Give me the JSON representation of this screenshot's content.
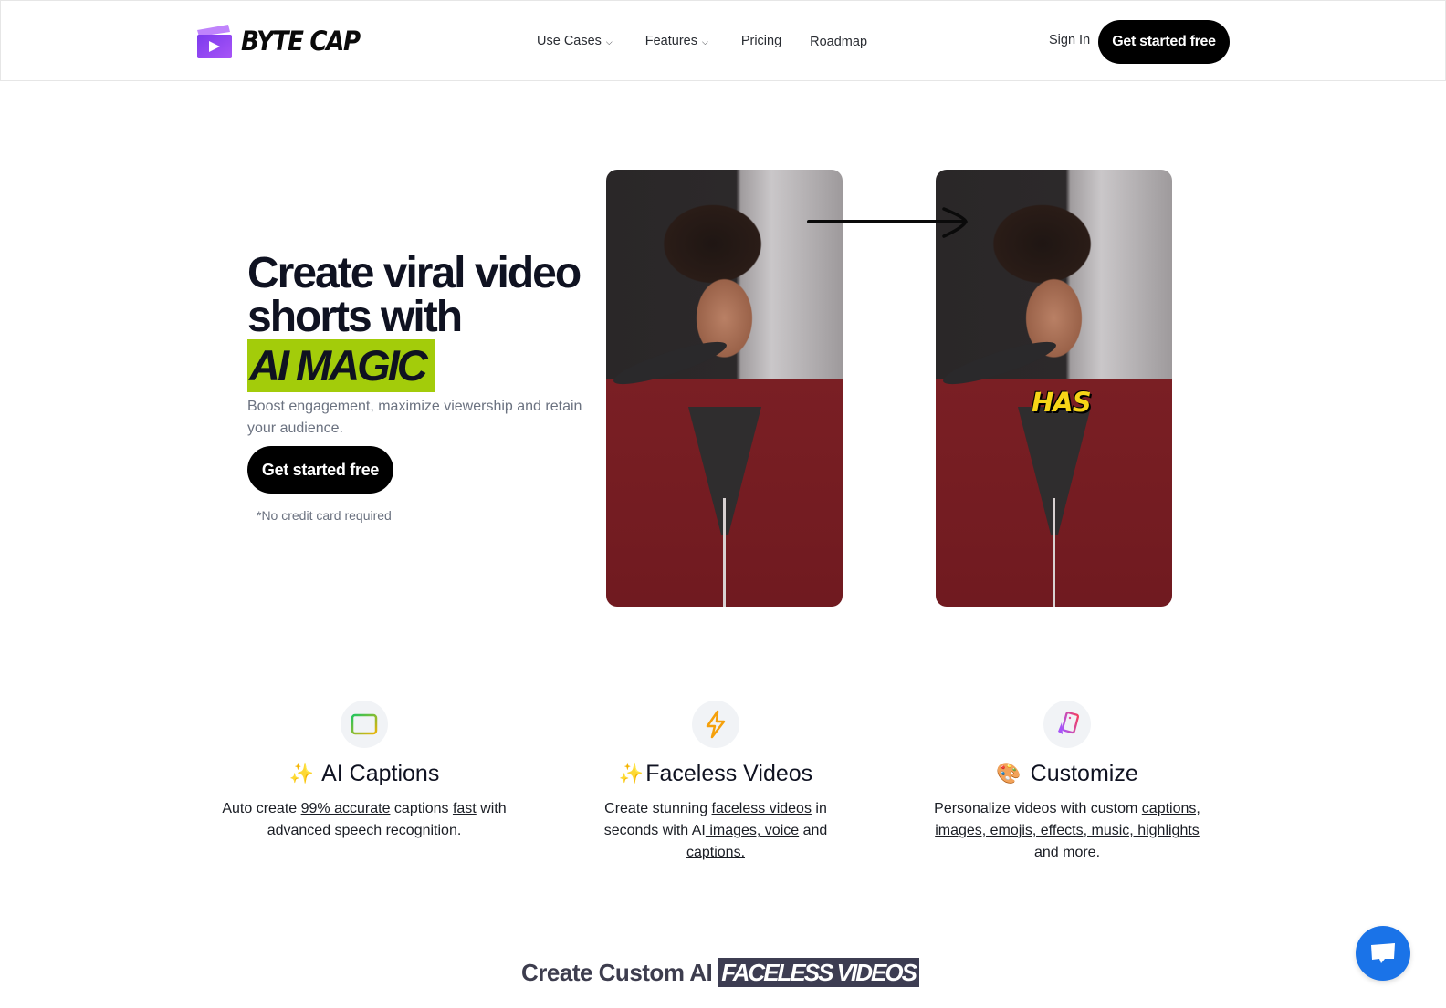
{
  "header": {
    "logo_text": "BYTE CAP",
    "nav": [
      {
        "label": "Use Cases",
        "has_dropdown": true
      },
      {
        "label": "Features",
        "has_dropdown": true
      },
      {
        "label": "Pricing",
        "has_dropdown": false
      },
      {
        "label": "Roadmap",
        "has_dropdown": false
      }
    ],
    "sign_in": "Sign In",
    "cta": "Get started free"
  },
  "hero": {
    "title_line1": "Create viral video",
    "title_line2": "shorts with",
    "highlight": "AI MAGIC",
    "subtitle": "Boost engagement, maximize viewership and retain your audience.",
    "cta": "Get started free",
    "note": "*No credit card required",
    "video_caption_word": "HAS",
    "colors": {
      "highlight": "#a3cc0a",
      "caption": "#f7d417"
    }
  },
  "features": [
    {
      "icon": "captions-icon",
      "emoji": "✨",
      "title": "AI Captions",
      "desc_parts": [
        "Auto create ",
        "99% accurate",
        " captions ",
        "fast",
        " with advanced speech recognition."
      ]
    },
    {
      "icon": "lightning-icon",
      "emoji": "✨",
      "title": "Faceless Videos",
      "desc_parts": [
        "Create stunning ",
        "faceless videos",
        " in seconds with AI",
        " images, voice",
        " and ",
        "captions."
      ]
    },
    {
      "icon": "cards-icon",
      "emoji": "🎨",
      "title": "Customize",
      "desc_parts": [
        "Personalize videos with custom ",
        "captions,",
        " ",
        "images, emojis, effects, music, highlights",
        " and more."
      ]
    }
  ],
  "section2": {
    "title_prefix": "Create Custom AI",
    "title_highlight": "FACELESS VIDEOS"
  },
  "chat": {
    "icon": "chat-bubble-icon",
    "color": "#1a73e8"
  }
}
